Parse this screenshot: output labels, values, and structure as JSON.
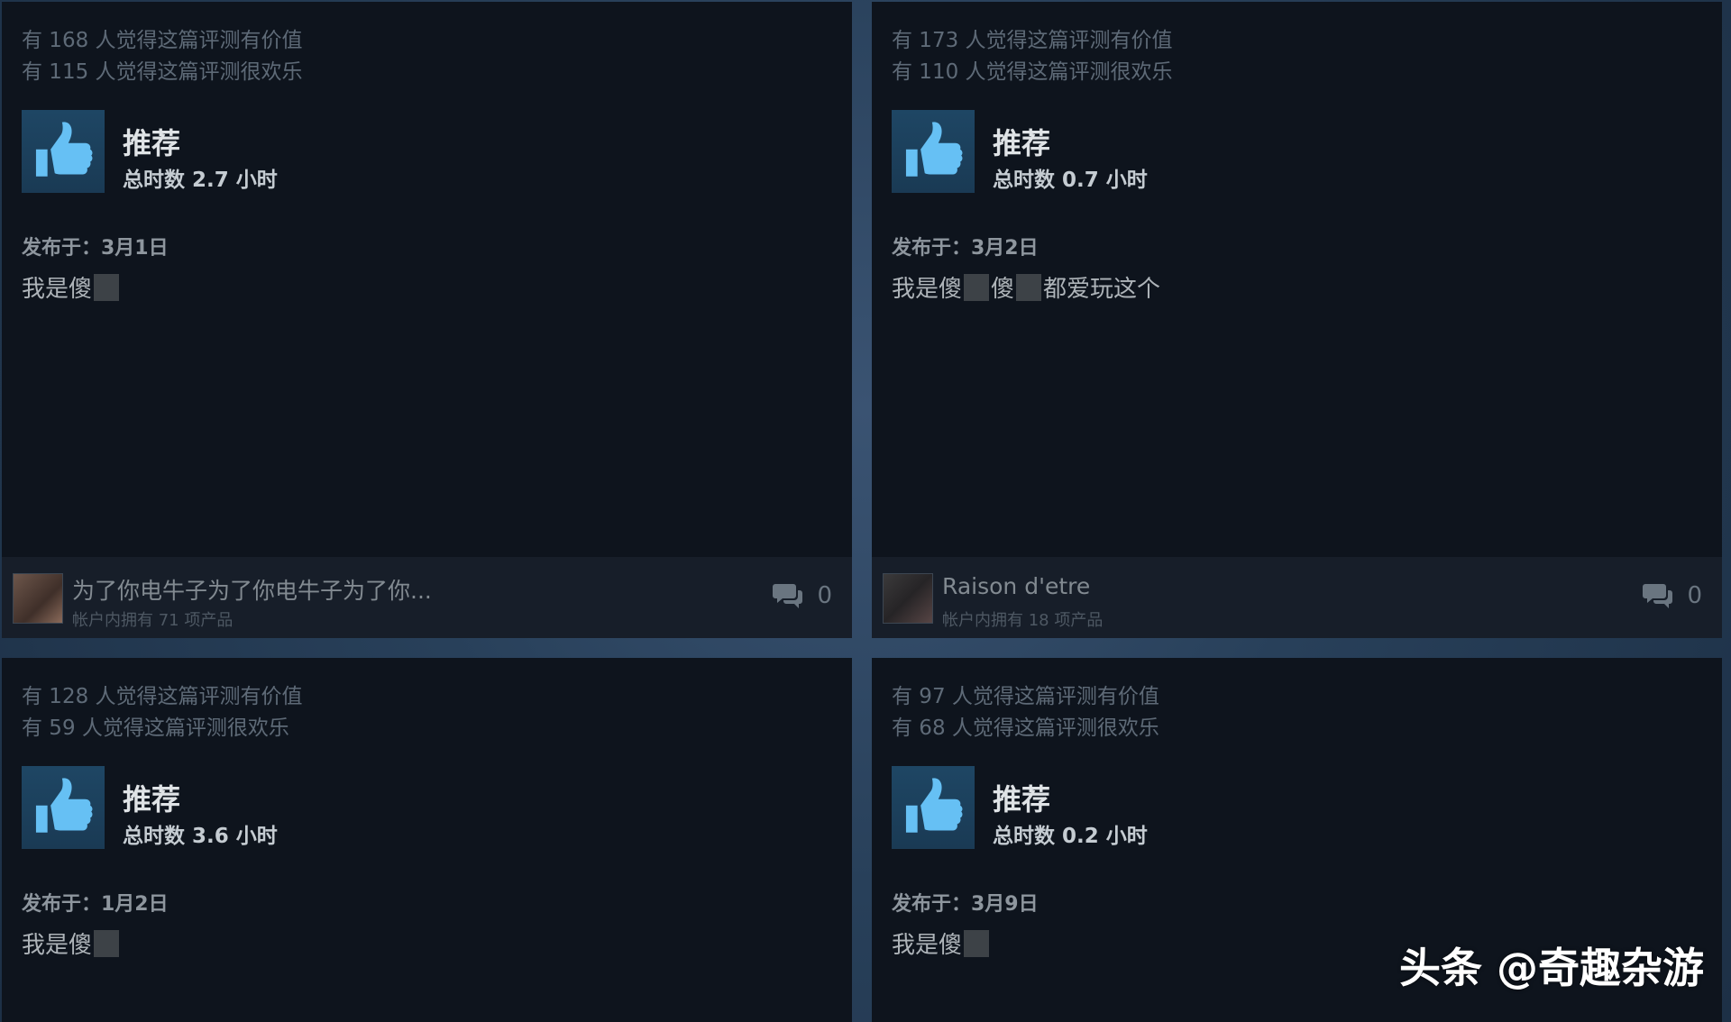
{
  "reviews": [
    {
      "helpful": "有 168 人觉得这篇评测有价值",
      "funny": "有 115 人觉得这篇评测很欢乐",
      "recommend": "推荐",
      "hours": "总时数 2.7 小时",
      "posted": "发布于：3月1日",
      "text_part1": "我是傻",
      "text_part2": "",
      "author": "为了你电牛子为了你电牛子为了你...",
      "owned": "帐户内拥有 71 项产品",
      "comments": "0"
    },
    {
      "helpful": "有 173 人觉得这篇评测有价值",
      "funny": "有 110 人觉得这篇评测很欢乐",
      "recommend": "推荐",
      "hours": "总时数 0.7 小时",
      "posted": "发布于：3月2日",
      "text_part1": "我是傻",
      "text_part2": " 傻",
      "text_part3": "都爱玩这个",
      "author": "Raison d'etre",
      "owned": "帐户内拥有 18 项产品",
      "comments": "0"
    },
    {
      "helpful": "有 128 人觉得这篇评测有价值",
      "funny": "有 59 人觉得这篇评测很欢乐",
      "recommend": "推荐",
      "hours": "总时数 3.6 小时",
      "posted": "发布于：1月2日",
      "text_part1": "我是傻"
    },
    {
      "helpful": "有 97 人觉得这篇评测有价值",
      "funny": "有 68 人觉得这篇评测很欢乐",
      "recommend": "推荐",
      "hours": "总时数 0.2 小时",
      "posted": "发布于：3月9日",
      "text_part1": "我是傻"
    }
  ],
  "watermark": "头条 @奇趣杂游",
  "icons": {
    "recommend": "thumbs-up-icon",
    "comments": "comment-bubble-icon"
  },
  "colors": {
    "card_bg": "#0e141d",
    "thumb_blue": "#66c0f4",
    "footer_bg": "#171e29"
  }
}
